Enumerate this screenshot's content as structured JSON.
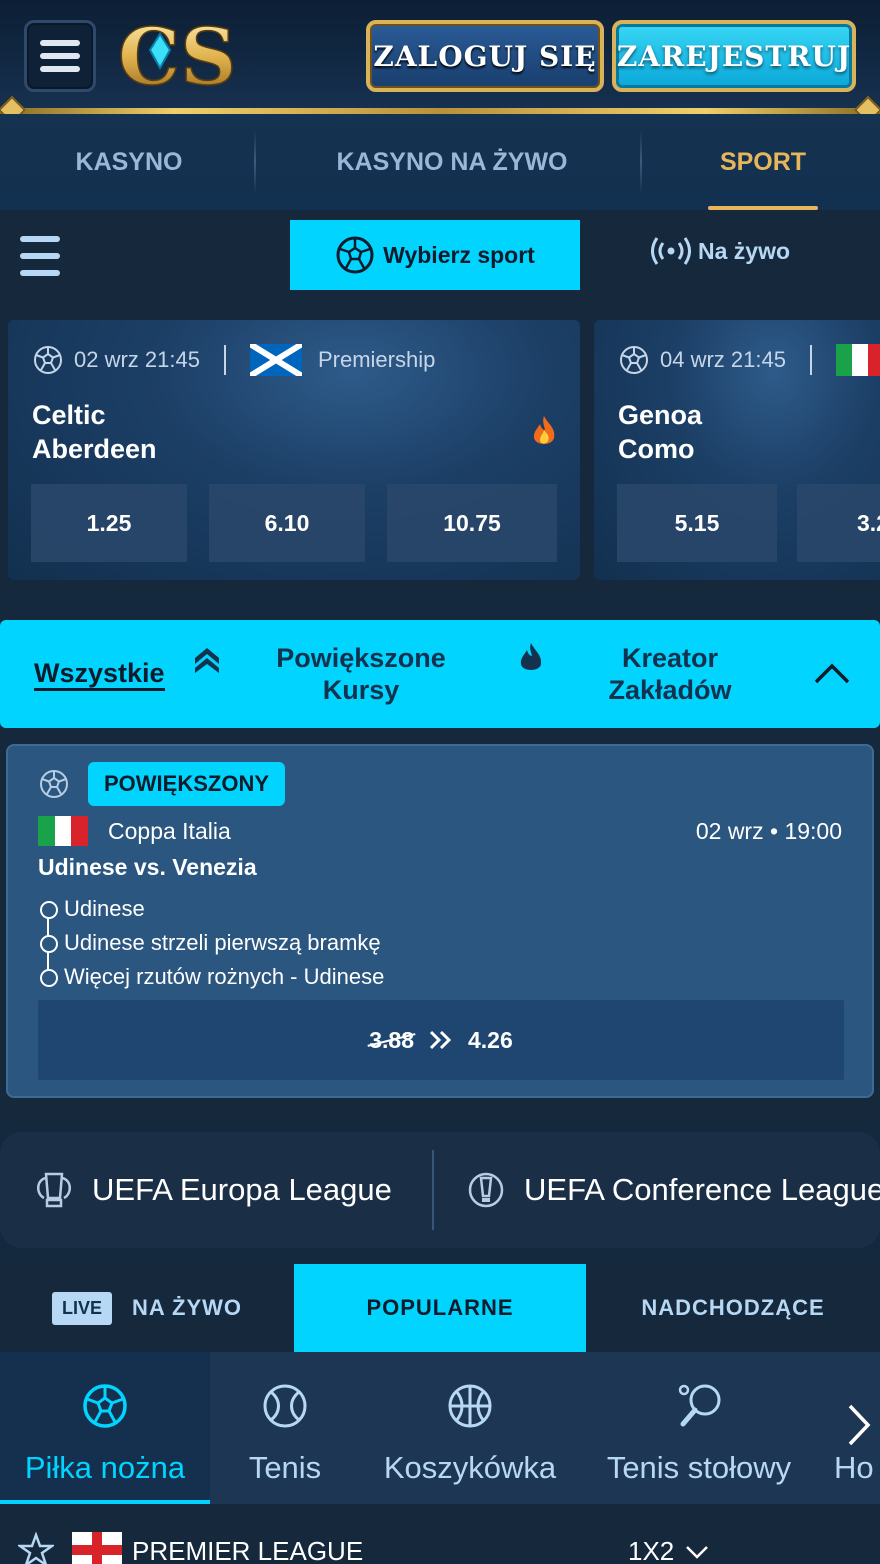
{
  "header": {
    "login_label": "ZALOGUJ SIĘ",
    "register_label": "ZAREJESTRUJ",
    "logo_text": "CS",
    "accent_gold": "#e8b65a",
    "accent_cyan": "#00d4ff"
  },
  "topnav": [
    {
      "label": "KASYNO"
    },
    {
      "label": "KASYNO NA ŻYWO"
    },
    {
      "label": "SPORT",
      "active": true
    }
  ],
  "sportbar": {
    "choose_sport": "Wybierz sport",
    "live": "Na żywo"
  },
  "featured": [
    {
      "datetime": "02 wrz 21:45",
      "competition": "Premiership",
      "team1": "Celtic",
      "team2": "Aberdeen",
      "hot": true,
      "odds": [
        "1.25",
        "6.10",
        "10.75"
      ]
    },
    {
      "datetime": "04 wrz 21:45",
      "competition": "",
      "team1": "Genoa",
      "team2": "Como",
      "odds": [
        "5.15",
        "3.2"
      ]
    }
  ],
  "filters": {
    "all": "Wszystkie",
    "boosted_line1": "Powiększone",
    "boosted_line2": "Kursy",
    "builder_line1": "Kreator",
    "builder_line2": "Zakładów"
  },
  "boost": {
    "badge": "POWIĘKSZONY",
    "competition": "Coppa Italia",
    "date": "02 wrz",
    "sep": "•",
    "time": "19:00",
    "match": "Udinese vs. Venezia",
    "selections": [
      "Udinese",
      "Udinese strzeli pierwszą bramkę",
      "Więcej rzutów rożnych - Udinese"
    ],
    "old_odds": "3.88",
    "new_odds": "4.26"
  },
  "leagues": [
    "UEFA Europa League",
    "UEFA Conference League"
  ],
  "livetabs": {
    "live_badge": "LIVE",
    "live": "NA ŻYWO",
    "popular": "POPULARNE",
    "upcoming": "NADCHODZĄCE"
  },
  "sports": [
    {
      "label": "Piłka nożna",
      "icon": "soccer-ball-icon",
      "active": true
    },
    {
      "label": "Tenis",
      "icon": "tennis-ball-icon"
    },
    {
      "label": "Koszykówka",
      "icon": "basketball-icon"
    },
    {
      "label": "Tenis stołowy",
      "icon": "table-tennis-icon"
    },
    {
      "label": "Ho",
      "icon": ""
    }
  ],
  "league_row": {
    "name": "PREMIER LEAGUE",
    "market": "1X2"
  }
}
